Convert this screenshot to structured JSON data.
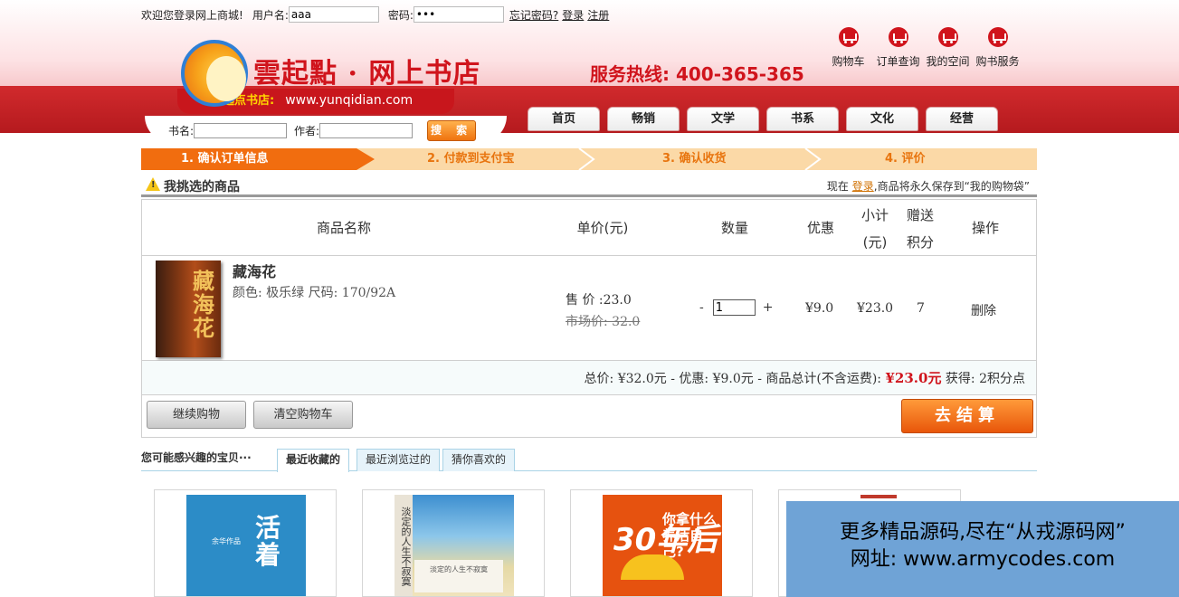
{
  "login": {
    "welcome": "欢迎您登录网上商城!",
    "username_label": "用户名:",
    "username_value": "aaa",
    "password_label": "密码:",
    "password_value": "•••",
    "forgot": "忘记密码?",
    "login": "登录",
    "register": "注册"
  },
  "logo": {
    "title": "雲起點 · 网上书店",
    "tag": "起点书店:",
    "url": "www.yunqidian.com"
  },
  "hotline": "服务热线: 400-365-365",
  "quick_links": [
    "购物车",
    "订单查询",
    "我的空间",
    "购书服务"
  ],
  "search": {
    "book_label": "书名:",
    "author_label": "作者:",
    "button": "搜 索"
  },
  "nav": [
    "首页",
    "畅销",
    "文学",
    "书系",
    "文化",
    "经营"
  ],
  "steps": [
    "1. 确认订单信息",
    "2. 付款到支付宝",
    "3. 确认收货",
    "4. 评价"
  ],
  "selection": {
    "title": "我挑选的商品",
    "note_prefix": "现在",
    "note_link": "登录",
    "note_suffix": ",商品将永久保存到“我的购物袋”"
  },
  "cart_headers": {
    "name": "商品名称",
    "price": "单价(元)",
    "qty": "数量",
    "discount": "优惠",
    "subtotal_1": "小计",
    "subtotal_2": "(元)",
    "points_1": "赠送",
    "points_2": "积分",
    "action": "操作"
  },
  "cart_item": {
    "name": "藏海花",
    "attrs": "颜色: 极乐绿 尺码: 170/92A",
    "cover_title": "藏海花",
    "sale_price": "售 价 :23.0",
    "market_price": "市场价: 32.0",
    "qty_minus": "-",
    "qty_value": "1",
    "qty_plus": "+",
    "discount": "¥9.0",
    "subtotal": "¥23.0",
    "points": "7",
    "delete": "删除"
  },
  "summary": {
    "text": "总价: ¥32.0元 - 优惠: ¥9.0元 - 商品总计(不含运费):",
    "total": "¥23.0元",
    "points": "获得: 2积分点"
  },
  "buttons": {
    "continue": "继续购物",
    "clear": "清空购物车",
    "checkout": "去结算"
  },
  "recommend": {
    "title": "您可能感兴趣的宝贝···",
    "tabs": [
      "最近收藏的",
      "最近浏览过的",
      "猜你喜欢的"
    ],
    "covers": [
      {
        "title": "活着",
        "author": "余华作品"
      },
      {
        "title": "淡定的人生不寂寞",
        "side": "淡定的人生不寂寞"
      },
      {
        "num": "30年后",
        "question": "你拿什么养活自己?"
      }
    ]
  },
  "watermark": {
    "line1": "更多精品源码,尽在“从戎源码网”",
    "line2": "网址: www.armycodes.com"
  },
  "colors": {
    "brand_red": "#d0141c",
    "step_active": "#f16d0f",
    "step_bg": "#fbd9a7",
    "checkout": "#e8560a"
  }
}
